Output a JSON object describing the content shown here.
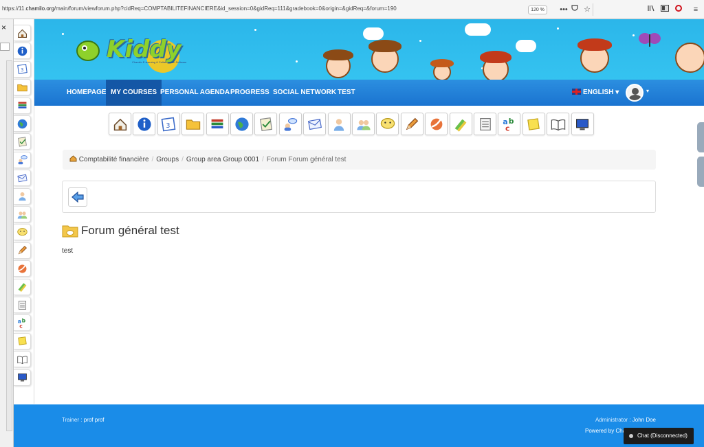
{
  "browser": {
    "url_prefix": "https://11.",
    "url_host": "chamilo.org",
    "url_rest": "/main/forum/viewforum.php?cidReq=COMPTABILITEFINANCIERE&id_session=0&gidReq=111&gradebook=0&origin=&gidReq=&forum=190",
    "zoom": "120 %",
    "icons": [
      "more-icon",
      "pocket-icon",
      "bookmark-star-icon",
      "library-icon",
      "sidebar-icon",
      "opera-icon",
      "menu-icon"
    ]
  },
  "sidebar_left": {
    "close_symbol": "×"
  },
  "banner": {
    "logo_text": "Kiddy",
    "logo_subtitle": "Chamilo E-learning & Collaboration Software"
  },
  "nav": {
    "items": [
      "HOMEPAGE",
      "MY COURSES",
      "PERSONAL AGENDA",
      "PROGRESS",
      "SOCIAL NETWORK",
      "TEST"
    ],
    "active": "MY COURSES",
    "language": "ENGLISH",
    "caret": "▾"
  },
  "course_tools": [
    "home-icon",
    "info-icon",
    "calendar-icon",
    "folder-icon",
    "books-icon",
    "globe-icon",
    "assignment-icon",
    "users-chat-icon",
    "mail-icon",
    "user-icon",
    "group-icon",
    "chat-icon",
    "pencil-icon",
    "ball-icon",
    "pencils-icon",
    "notes-icon",
    "glossary-icon",
    "sticky-note-icon",
    "book-icon",
    "monitor-icon"
  ],
  "breadcrumb": {
    "items": [
      "Comptabilité financière",
      "Groups",
      "Group area Group 0001",
      "Forum Forum général test"
    ],
    "separator": "/"
  },
  "forum": {
    "title": "Forum général test",
    "description": "test"
  },
  "footer": {
    "trainer_label": "Trainer : ",
    "trainer_name": "prof prof",
    "admin_label": "Administrator : ",
    "admin_name": "John Doe",
    "powered_by": "Powered by Cha"
  },
  "chat": {
    "label": "Chat (Disconnected)"
  },
  "colors": {
    "nav_blue": "#1a73d0",
    "nav_active": "#1457a6",
    "banner_blue": "#2bb6ea",
    "footer_blue": "#1a8ce8"
  }
}
